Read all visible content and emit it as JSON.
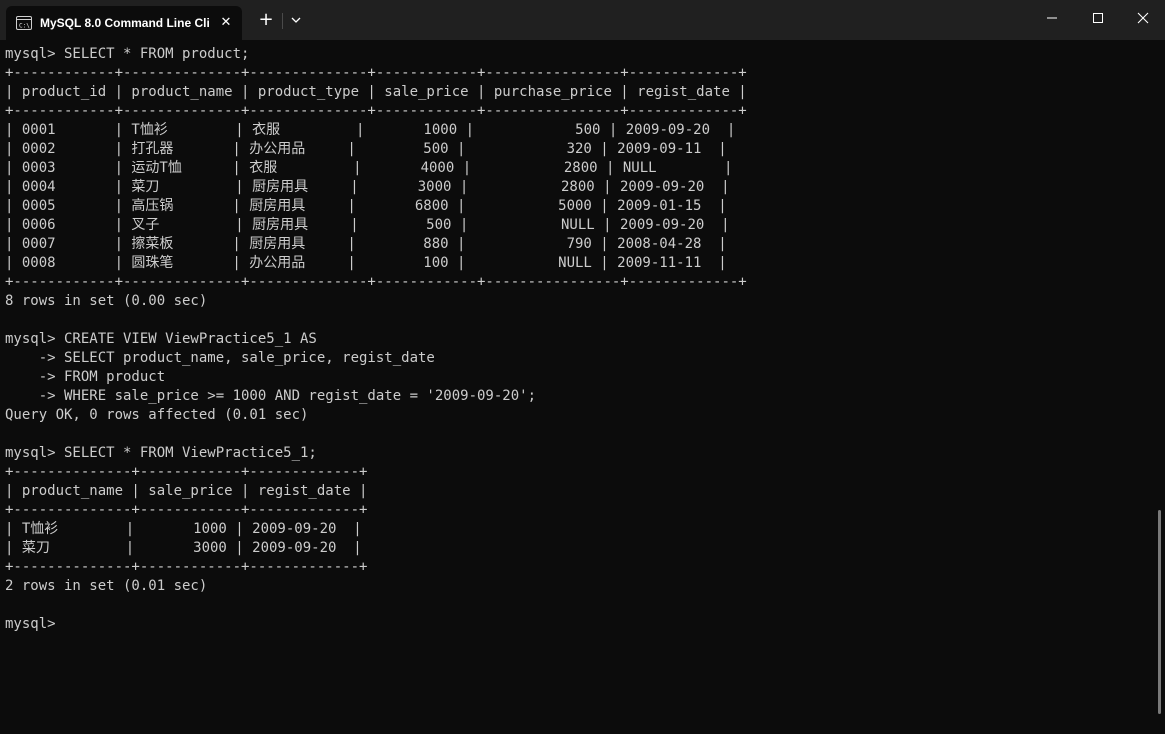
{
  "window": {
    "tab_title": "MySQL 8.0 Command Line Cli",
    "tab_icon": "console-icon",
    "new_tab_label": "+",
    "close_tab_label": "✕"
  },
  "terminal": {
    "lines": [
      "mysql> SELECT * FROM product;",
      "+------------+--------------+--------------+------------+----------------+-------------+",
      "| product_id | product_name | product_type | sale_price | purchase_price | regist_date |",
      "+------------+--------------+--------------+------------+----------------+-------------+",
      "| 0001       | T恤衫        | 衣服         |       1000 |            500 | 2009-09-20  |",
      "| 0002       | 打孔器       | 办公用品     |        500 |            320 | 2009-09-11  |",
      "| 0003       | 运动T恤      | 衣服         |       4000 |           2800 | NULL        |",
      "| 0004       | 菜刀         | 厨房用具     |       3000 |           2800 | 2009-09-20  |",
      "| 0005       | 高压锅       | 厨房用具     |       6800 |           5000 | 2009-01-15  |",
      "| 0006       | 叉子         | 厨房用具     |        500 |           NULL | 2009-09-20  |",
      "| 0007       | 擦菜板       | 厨房用具     |        880 |            790 | 2008-04-28  |",
      "| 0008       | 圆珠笔       | 办公用品     |        100 |           NULL | 2009-11-11  |",
      "+------------+--------------+--------------+------------+----------------+-------------+",
      "8 rows in set (0.00 sec)",
      "",
      "mysql> CREATE VIEW ViewPractice5_1 AS",
      "    -> SELECT product_name, sale_price, regist_date",
      "    -> FROM product",
      "    -> WHERE sale_price >= 1000 AND regist_date = '2009-09-20';",
      "Query OK, 0 rows affected (0.01 sec)",
      "",
      "mysql> SELECT * FROM ViewPractice5_1;",
      "+--------------+------------+-------------+",
      "| product_name | sale_price | regist_date |",
      "+--------------+------------+-------------+",
      "| T恤衫        |       1000 | 2009-09-20  |",
      "| 菜刀         |       3000 | 2009-09-20  |",
      "+--------------+------------+-------------+",
      "2 rows in set (0.01 sec)",
      "",
      "mysql>"
    ]
  },
  "colors": {
    "background": "#0c0c0c",
    "titlebar": "#202020",
    "text": "#cccccc"
  }
}
